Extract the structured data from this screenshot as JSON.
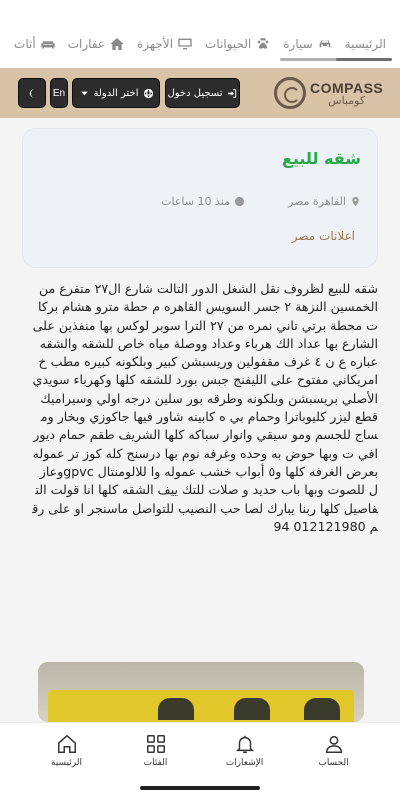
{
  "categories": [
    {
      "label": "الرئيسية",
      "icon": "home-nav-icon"
    },
    {
      "label": "سيارة",
      "icon": "car-icon"
    },
    {
      "label": "الحيوانات",
      "icon": "paw-icon"
    },
    {
      "label": "الأجهزة",
      "icon": "monitor-icon"
    },
    {
      "label": "عقارات",
      "icon": "house-icon"
    },
    {
      "label": "أثاث",
      "icon": "sofa-icon"
    },
    {
      "label": "",
      "icon": "more-category-icon"
    }
  ],
  "header": {
    "logo_en": "COMPASS",
    "logo_ar": "كومباس",
    "login_label": "تسجيل دخول",
    "country_label": "اختر الدولة",
    "lang_label": "En"
  },
  "listing": {
    "title": "شقه للبيع",
    "location": "القاهرة مصر",
    "time": "منذ 10 ساعات",
    "seller": "اعلانات مصر",
    "description": "شقه للبيع لظروف نقل الشغل الدور التالت شارع ال٢٧ متفرع من الخمسين النزهة ٢ جسر السويس القاهره م حطة مترو هشام بركات محطة برتي تاني نمره من ٢٧ الترا سوبر لوكس بها منفذين على الشارع بها عداد الك هرباء وعداد ووصلة مياه خاص للشقه والشقه عباره ع ن ٤ غرف مقفولين وريسبشن كبير وبلكونه كبيره مطب خ امريكاني مفتوح على الليفنج جبس بورد للشقه كلها وكهرباء سويدي الأصلي بريسبشن وبلكونه وطرقه بور سلين درجه اولي وسيراميك قطع ليزر كليوباترا وحمام بي ه كابينه شاور فيها جاكوزي وبخار ومساج للجسم ومو سيقي وانوار سباكه كلها الشريف طقم حمام ديورافي ت وبها حوض به وحده وغرفه نوم بها درسنج كله كوز تر عموله بعرض الغرفه كلها و٥ أبواب خشب عموله وا للالومنتال gpvcوعازل للصوت وبها باب حديد و صلات للتك ييف الشقه كلها انا قولت التفاصيل كلها ربنا يبارك لصا حب النصيب للتواصل ماسنجر او على رقم 012121980 94"
  },
  "bottom_nav": [
    {
      "label": "الحساب",
      "icon": "user-icon"
    },
    {
      "label": "الإشعارات",
      "icon": "bell-icon"
    },
    {
      "label": "الفئات",
      "icon": "grid-icon"
    },
    {
      "label": "الرئيسية",
      "icon": "home-icon"
    }
  ]
}
